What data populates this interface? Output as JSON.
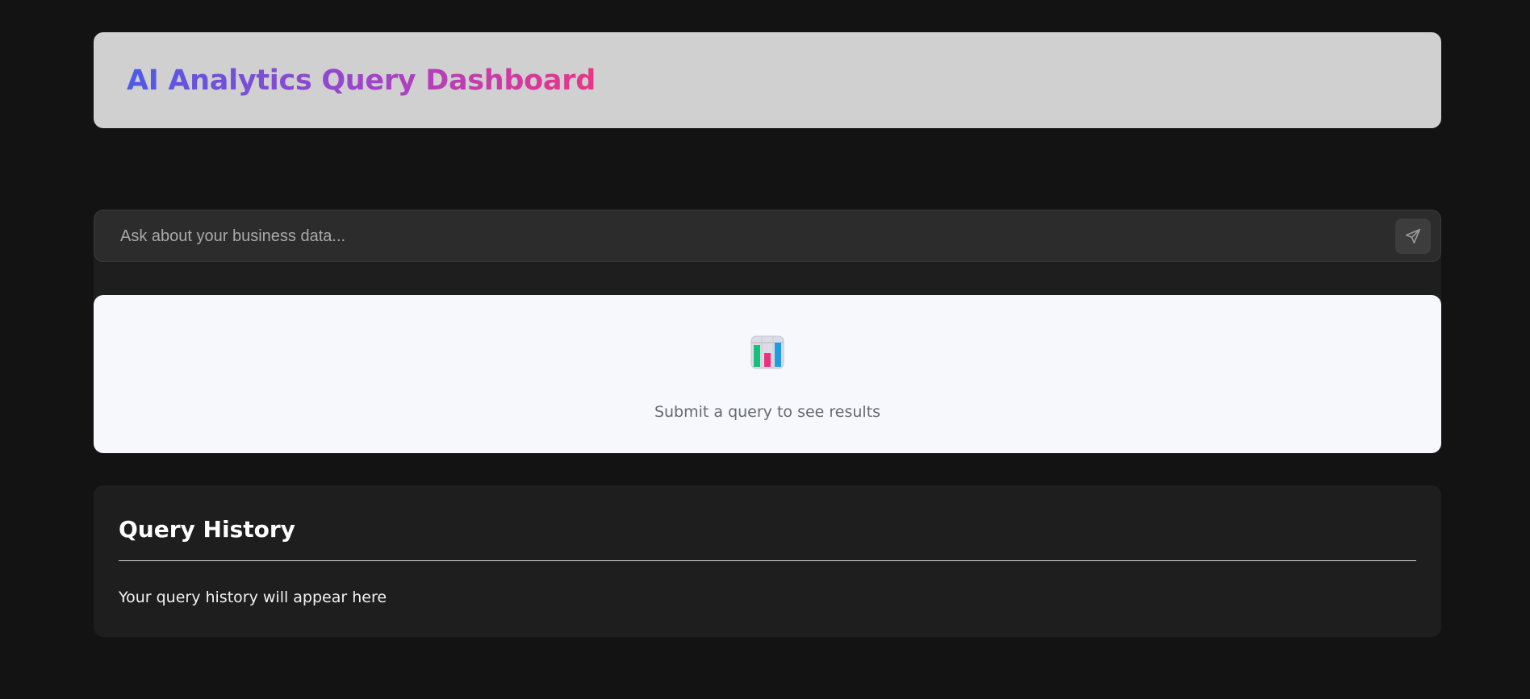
{
  "header": {
    "title": "AI Analytics Query Dashboard",
    "gradient": [
      "#4f5ae6",
      "#a642c8",
      "#ec3488"
    ]
  },
  "search": {
    "placeholder": "Ask about your business data...",
    "value": "",
    "send_icon": "send-icon"
  },
  "results": {
    "icon": "bar-chart-icon",
    "empty_message": "Submit a query to see results"
  },
  "history": {
    "title": "Query History",
    "empty_message": "Your query history will appear here"
  },
  "colors": {
    "page_background": "#131313",
    "panel_background": "#1e1e1e",
    "header_background": "#d0d0d0",
    "results_background": "#f6f8fb"
  }
}
